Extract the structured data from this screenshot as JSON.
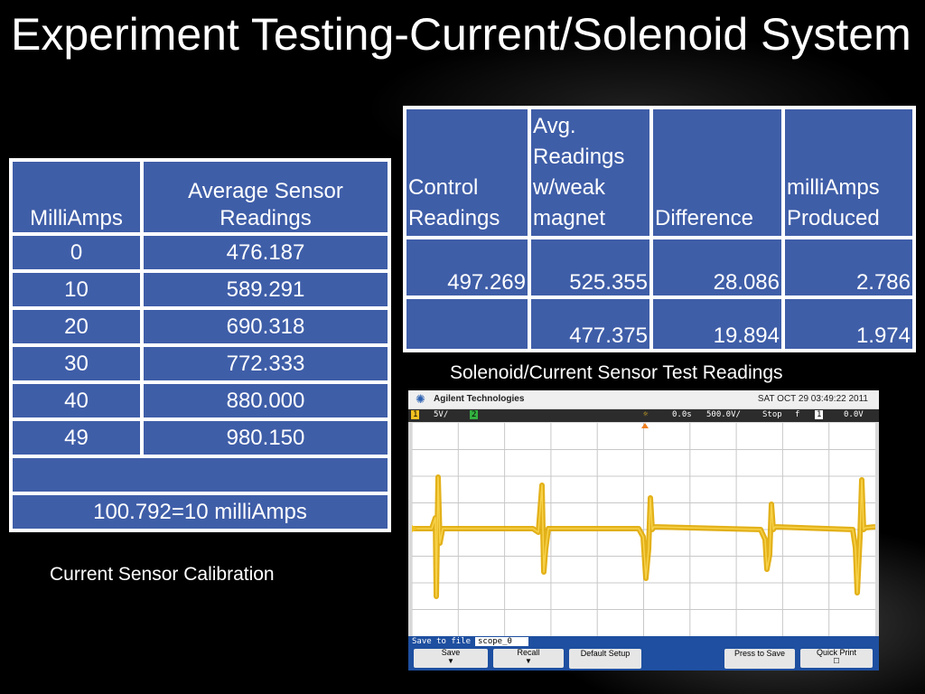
{
  "title": "Experiment Testing-Current/Solenoid System",
  "calibration": {
    "headers": [
      "MilliAmps",
      "Average Sensor Readings"
    ],
    "rows": [
      [
        "0",
        "476.187"
      ],
      [
        "10",
        "589.291"
      ],
      [
        "20",
        "690.318"
      ],
      [
        "30",
        "772.333"
      ],
      [
        "40",
        "880.000"
      ],
      [
        "49",
        "980.150"
      ]
    ],
    "note": "100.792=10 milliAmps",
    "caption": "Current Sensor Calibration"
  },
  "test": {
    "headers": [
      "Control Readings",
      "Avg. Readings w/weak magnet",
      "Difference",
      "milliAmps Produced"
    ],
    "rows": [
      [
        "497.269",
        "525.355",
        "28.086",
        "2.786"
      ],
      [
        "",
        "477.375",
        "19.894",
        "1.974"
      ]
    ],
    "caption": "Solenoid/Current Sensor Test Readings"
  },
  "scope": {
    "brand": "Agilent Technologies",
    "datetime": "SAT OCT 29 03:49:22 2011",
    "ch1_label": "1",
    "ch1_scale": "5V/",
    "ch2_label": "2",
    "delay": "0.0s",
    "timebase": "500.0V/",
    "run_state": "Stop",
    "trigger_symbol": "f",
    "trigger_ch": "1",
    "trigger_level": "0.0V",
    "save_label": "Save to file =",
    "filename": "scope_0",
    "softkeys": [
      "Save",
      "Recall",
      "Default Setup",
      "Press to Save",
      "Quick Print"
    ],
    "trace_color": "#e0a800"
  }
}
